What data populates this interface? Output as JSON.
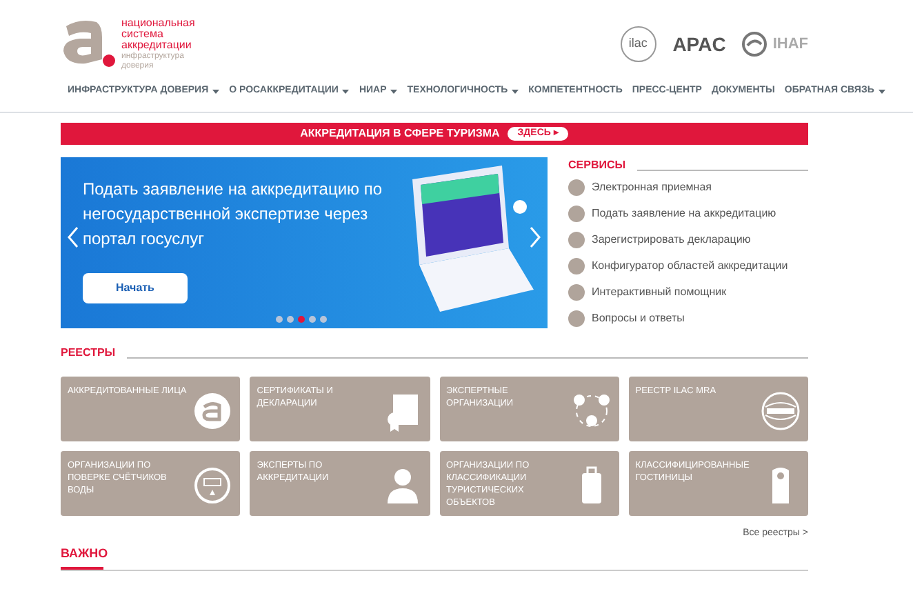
{
  "logo": {
    "title": "национальная система аккредитации",
    "subtitle": "инфраструктура доверия"
  },
  "partners": [
    {
      "label": "ilac"
    },
    {
      "label": "APAC"
    },
    {
      "label": "IHAF"
    }
  ],
  "nav": [
    {
      "label": "ИНФРАСТРУКТУРА ДОВЕРИЯ",
      "dropdown": true
    },
    {
      "label": "О РОСАККРЕДИТАЦИИ",
      "dropdown": true
    },
    {
      "label": "НИАР",
      "dropdown": true
    },
    {
      "label": "ТЕХНОЛОГИЧНОСТЬ",
      "dropdown": true
    },
    {
      "label": "КОМПЕТЕНТНОСТЬ",
      "dropdown": false
    },
    {
      "label": "ПРЕСС-ЦЕНТР",
      "dropdown": false
    },
    {
      "label": "ДОКУМЕНТЫ",
      "dropdown": false
    },
    {
      "label": "ОБРАТНАЯ СВЯЗЬ",
      "dropdown": true
    }
  ],
  "banner": {
    "text": "АККРЕДИТАЦИЯ В СФЕРЕ ТУРИЗМА",
    "button": "ЗДЕСЬ ▸"
  },
  "slider": {
    "headline": "Подать заявление на аккредитацию по негосударственной экспертизе через портал госуслуг",
    "button": "Начать",
    "dots": [
      {
        "selected": false
      },
      {
        "selected": false
      },
      {
        "selected": true
      },
      {
        "selected": false
      },
      {
        "selected": false
      }
    ]
  },
  "services": {
    "title": "СЕРВИСЫ",
    "items": [
      {
        "label": "Электронная приемная"
      },
      {
        "label": "Подать заявление на аккредитацию"
      },
      {
        "label": "Зарегистрировать декларацию"
      },
      {
        "label": "Конфигуратор областей аккредитации"
      },
      {
        "label": "Интерактивный помощник"
      },
      {
        "label": "Вопросы и ответы"
      }
    ]
  },
  "registries": {
    "title": "РЕЕСТРЫ",
    "tiles": [
      {
        "label": "АККРЕДИТОВАННЫЕ ЛИЦА",
        "kind": "logo"
      },
      {
        "label": "СЕРТИФИКАТЫ И ДЕКЛАРАЦИИ",
        "kind": "certificate"
      },
      {
        "label": "ЭКСПЕРТНЫЕ ОРГАНИЗАЦИИ",
        "kind": "network"
      },
      {
        "label": "РЕЕСТР ILAC MRA",
        "kind": "seal"
      },
      {
        "label": "ОРГАНИЗАЦИИ ПО ПОВЕРКЕ СЧЁТЧИКОВ ВОДЫ",
        "kind": "meter"
      },
      {
        "label": "ЭКСПЕРТЫ ПО АККРЕДИТАЦИИ",
        "kind": "person"
      },
      {
        "label": "ОРГАНИЗАЦИИ ПО КЛАССИФИКАЦИИ ТУРИСТИЧЕСКИХ ОБЪЕКТОВ",
        "kind": "suitcase"
      },
      {
        "label": "КЛАССИФИЦИРОВАННЫЕ ГОСТИНИЦЫ",
        "kind": "hanger"
      }
    ],
    "all_link": "Все реестры >"
  },
  "important": {
    "title": "ВАЖНО"
  }
}
